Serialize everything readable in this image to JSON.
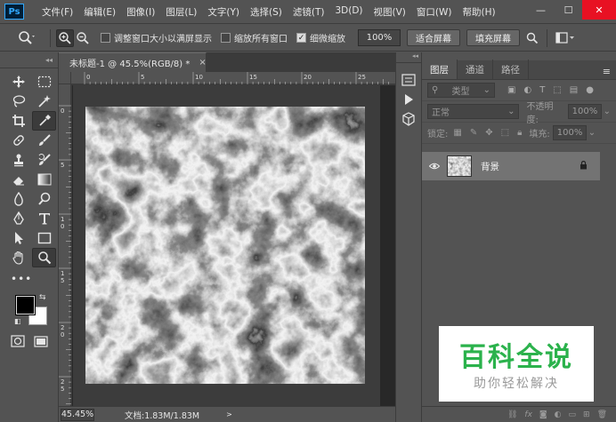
{
  "app": {
    "logo_text": "Ps"
  },
  "menu": [
    "文件(F)",
    "编辑(E)",
    "图像(I)",
    "图层(L)",
    "文字(Y)",
    "选择(S)",
    "滤镜(T)",
    "3D(D)",
    "视图(V)",
    "窗口(W)",
    "帮助(H)"
  ],
  "window_controls": {
    "minimize": "—",
    "maximize": "☐",
    "close": "✕"
  },
  "options_bar": {
    "resize_windows_label": "调整窗口大小以满屏显示",
    "resize_windows_checked": false,
    "zoom_all_label": "缩放所有窗口",
    "zoom_all_checked": false,
    "scrubby_zoom_label": "细微缩放",
    "scrubby_zoom_checked": true,
    "zoom_percent": "100%",
    "fit_screen_label": "适合屏幕",
    "fill_screen_label": "填充屏幕"
  },
  "document": {
    "tab_title": "未标题-1 @ 45.5%(RGB/8) *",
    "close_glyph": "×",
    "ruler_h_labels": [
      "0",
      "5",
      "10",
      "15",
      "20",
      "25"
    ],
    "ruler_v_labels": [
      "0",
      "5",
      "1\n0",
      "1\n5",
      "2\n0",
      "2\n5"
    ],
    "status_zoom": "45.45%",
    "status_doc": "文档:1.83M/1.83M",
    "status_arrow": ">"
  },
  "layers_panel": {
    "tabs": [
      "图层",
      "通道",
      "路径"
    ],
    "active_tab": "图层",
    "filter_kind": "类型",
    "blend_mode": "正常",
    "opacity_label": "不透明度:",
    "opacity_value": "100%",
    "lock_label": "锁定:",
    "fill_label": "填充:",
    "fill_value": "100%",
    "layers": [
      {
        "name": "背景",
        "visible": true,
        "locked": true
      }
    ]
  },
  "watermark": {
    "title": "百科全说",
    "subtitle": "助你轻松解决"
  },
  "colors": {
    "accent_ps": "#31a8ff",
    "watermark_green": "#2bb24c",
    "close_red": "#e81123"
  }
}
